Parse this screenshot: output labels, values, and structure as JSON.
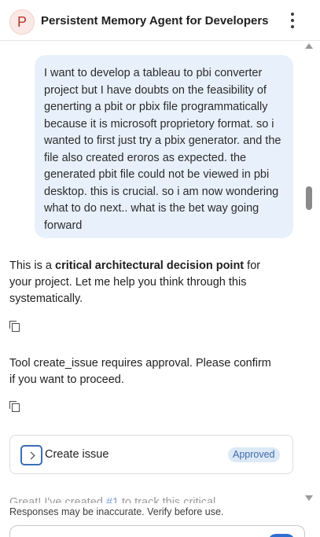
{
  "header": {
    "avatar_letter": "P",
    "title": "Persistent Memory Agent for Developers"
  },
  "conversation": {
    "user_message": "I want to develop a tableau to pbi converter project but I have doubts on the feasibility of generting a pbit or pbix file programmatically because it is microsoft proprietory format. so i wanted to first just try a pbix generator. and the file also created eroros as expected. the generated pbit file could not be viewed in pbi desktop. this is crucial. so i am now wondering what to do next.. what is the bet way going forward",
    "assistant_1": {
      "prefix": "This is a ",
      "bold": "critical architectural decision point",
      "suffix": " for your project. Let me help you think through this systematically."
    },
    "assistant_2": "Tool create_issue requires approval. Please confirm if you want to proceed.",
    "tool_card": {
      "label": "Create issue",
      "status": "Approved"
    },
    "partial_message": {
      "prefix": "Great! I've created ",
      "link": "#1",
      "suffix": " to track this critical"
    }
  },
  "footer": {
    "disclaimer": "Responses may be inaccurate. Verify before use."
  },
  "colors": {
    "user_bubble": "#e8f1fb",
    "badge_bg": "#dde9f7",
    "badge_text": "#3d6aa8",
    "accent": "#2f6fd1"
  }
}
